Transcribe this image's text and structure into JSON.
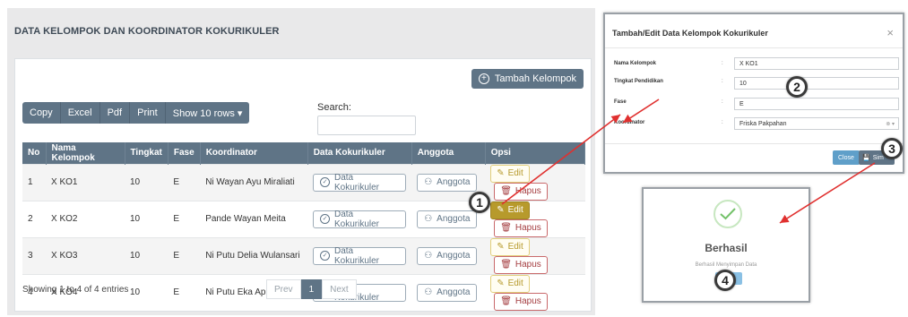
{
  "page_title": "DATA KELOMPOK DAN KOORDINATOR KOKURIKULER",
  "toolbar": {
    "add_label": "Tambah Kelompok",
    "buttons": [
      "Copy",
      "Excel",
      "Pdf",
      "Print",
      "Show 10 rows ▾"
    ],
    "search_label": "Search:"
  },
  "table": {
    "headers": [
      "No",
      "Nama Kelompok",
      "Tingkat",
      "Fase",
      "Koordinator",
      "Data Kokurikuler",
      "Anggota",
      "Opsi"
    ],
    "rows": [
      {
        "no": "1",
        "nama": "X KO1",
        "tingkat": "10",
        "fase": "E",
        "koordinator": "Ni Wayan Ayu Miraliati"
      },
      {
        "no": "2",
        "nama": "X KO2",
        "tingkat": "10",
        "fase": "E",
        "koordinator": "Pande Wayan Meita"
      },
      {
        "no": "3",
        "nama": "X KO3",
        "tingkat": "10",
        "fase": "E",
        "koordinator": "Ni Putu Delia Wulansari"
      },
      {
        "no": "4",
        "nama": "X KO4",
        "tingkat": "10",
        "fase": "E",
        "koordinator": "Ni Putu Eka Aprilyani"
      }
    ],
    "data_btn": "Data Kokurikuler",
    "anggota_btn": "Anggota",
    "edit_btn": "Edit",
    "hapus_btn": "Hapus"
  },
  "footer": {
    "info": "Showing 1 to 4 of 4 entries",
    "prev": "Prev",
    "page": "1",
    "next": "Next"
  },
  "modal": {
    "title": "Tambah/Edit Data Kelompok Kokurikuler",
    "close_icon": "×",
    "fields": [
      {
        "label": "Nama Kelompok",
        "value": "X KO1"
      },
      {
        "label": "Tingkat Pendidikan",
        "value": "10"
      },
      {
        "label": "Fase",
        "value": "E"
      },
      {
        "label": "Koordinator",
        "value": "Friska Pakpahan"
      }
    ],
    "colon": ":",
    "close_btn": "Close",
    "save_btn": "Sim"
  },
  "success": {
    "title": "Berhasil",
    "text": "Berhasil Menyimpan Data"
  },
  "steps": [
    "1",
    "2",
    "3",
    "4"
  ],
  "colors": {
    "primary": "#5f7486",
    "edit": "#b79a2c",
    "delete": "#a43d40",
    "arrow": "#e0302f",
    "success": "#74c26a"
  }
}
